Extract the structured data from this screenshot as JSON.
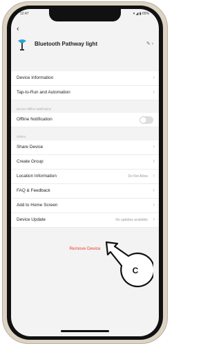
{
  "status": {
    "time": "12:47",
    "indicators": "▾ ◢ ▮ 65%"
  },
  "header": {
    "device_name": "Bluetooth Pathway light",
    "icon": "lamp-icon",
    "edit_icon": "pencil-icon"
  },
  "group1": [
    {
      "label": "Device Information"
    },
    {
      "label": "Tap-to-Run and Automation"
    }
  ],
  "section_offline": "Device Offline Notification",
  "offline": {
    "label": "Offline Notification",
    "enabled": false
  },
  "section_others": "Others",
  "group2": [
    {
      "label": "Share Device",
      "value": ""
    },
    {
      "label": "Create Group",
      "value": ""
    },
    {
      "label": "Location Information",
      "value": "Do Not Allow"
    },
    {
      "label": "FAQ & Feedback",
      "value": ""
    },
    {
      "label": "Add to Home Screen",
      "value": ""
    },
    {
      "label": "Device Update",
      "value": "No updates available"
    }
  ],
  "remove_label": "Remove Device",
  "callout": {
    "letter": "C"
  },
  "colors": {
    "danger": "#e8432e",
    "accent": "#2aa3d8"
  }
}
